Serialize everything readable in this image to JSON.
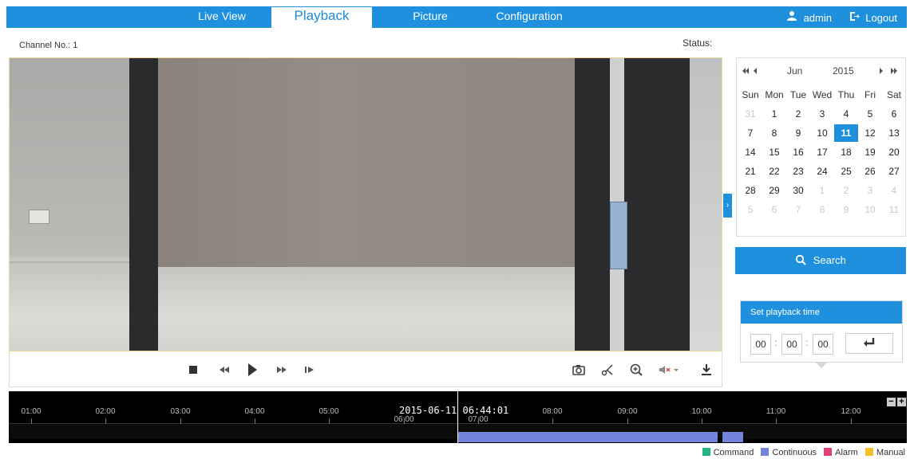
{
  "nav": {
    "tabs": [
      {
        "label": "Live View"
      },
      {
        "label": "Playback"
      },
      {
        "label": "Picture"
      },
      {
        "label": "Configuration"
      }
    ],
    "user": "admin",
    "logout": "Logout"
  },
  "header": {
    "channel": "Channel No.: 1",
    "status": "Status:"
  },
  "calendar": {
    "month": "Jun",
    "year": "2015",
    "weekdays": [
      "Sun",
      "Mon",
      "Tue",
      "Wed",
      "Thu",
      "Fri",
      "Sat"
    ],
    "weeks": [
      [
        "31",
        "1",
        "2",
        "3",
        "4",
        "5",
        "6"
      ],
      [
        "7",
        "8",
        "9",
        "10",
        "11",
        "12",
        "13"
      ],
      [
        "14",
        "15",
        "16",
        "17",
        "18",
        "19",
        "20"
      ],
      [
        "21",
        "22",
        "23",
        "24",
        "25",
        "26",
        "27"
      ],
      [
        "28",
        "29",
        "30",
        "1",
        "2",
        "3",
        "4"
      ],
      [
        "5",
        "6",
        "7",
        "8",
        "9",
        "10",
        "11"
      ]
    ],
    "selected": "11"
  },
  "search": {
    "label": "Search"
  },
  "playback_time": {
    "title": "Set playback time",
    "hh": "00",
    "mm": "00",
    "ss": "00"
  },
  "timeline": {
    "current": "2015-06-11 06:44:01",
    "ticks": [
      "01:00",
      "02:00",
      "03:00",
      "04:00",
      "05:00",
      "06:00",
      "07:00",
      "08:00",
      "09:00",
      "10:00",
      "11:00",
      "12:00"
    ]
  },
  "legend": [
    {
      "label": "Command",
      "color": "#26b487"
    },
    {
      "label": "Continuous",
      "color": "#6f84da"
    },
    {
      "label": "Alarm",
      "color": "#e0407a"
    },
    {
      "label": "Manual",
      "color": "#f2c12e"
    }
  ],
  "colors": {
    "accent": "#1e90de"
  }
}
